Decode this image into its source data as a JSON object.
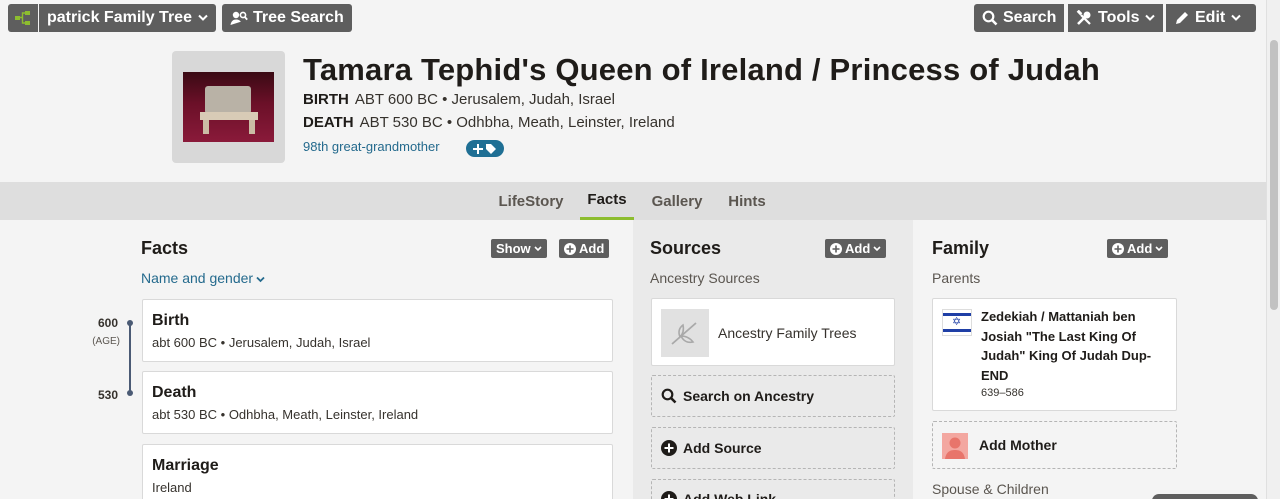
{
  "topbar": {
    "family_tree_label": "patrick Family Tree",
    "tree_search_label": "Tree Search",
    "search_label": "Search",
    "tools_label": "Tools",
    "edit_label": "Edit"
  },
  "person": {
    "name": "Tamara Tephid's Queen of Ireland / Princess of Judah",
    "birth_label": "BIRTH",
    "birth_value": "ABT 600 BC • Jerusalem, Judah, Israel",
    "death_label": "DEATH",
    "death_value": "ABT 530 BC • Odhbha, Meath, Leinster, Ireland",
    "relationship": "98th great-grandmother"
  },
  "tabs": [
    {
      "label": "LifeStory",
      "active": false
    },
    {
      "label": "Facts",
      "active": true
    },
    {
      "label": "Gallery",
      "active": false
    },
    {
      "label": "Hints",
      "active": false
    }
  ],
  "facts": {
    "heading": "Facts",
    "show_label": "Show",
    "add_label": "Add",
    "name_gender_link": "Name and gender",
    "timeline": {
      "start_year": "600",
      "start_age": "(AGE)",
      "end_year": "530"
    },
    "items": [
      {
        "title": "Birth",
        "detail": "abt 600 BC • Jerusalem, Judah, Israel"
      },
      {
        "title": "Death",
        "detail": "abt 530 BC • Odhbha, Meath, Leinster, Ireland"
      },
      {
        "title": "Marriage",
        "detail": "Ireland"
      }
    ]
  },
  "sources": {
    "heading": "Sources",
    "add_label": "Add",
    "subheading": "Ancestry Sources",
    "source_card_label": "Ancestry Family Trees",
    "search_on_ancestry": "Search on Ancestry",
    "add_source": "Add Source",
    "add_web_link": "Add Web Link"
  },
  "family": {
    "heading": "Family",
    "add_label": "Add",
    "parents_label": "Parents",
    "father_name": "Zedekiah / Mattaniah ben Josiah \"The Last King Of Judah\" King Of Judah Dup-END",
    "father_dates": "639–586",
    "add_mother_label": "Add Mother",
    "spouse_children_label": "Spouse & Children"
  },
  "colors": {
    "button_gray": "#5e5e5e",
    "link_blue": "#246a8d",
    "active_tab_underline": "#8dbd2f",
    "tree_icon_green": "#8dbd2f"
  }
}
